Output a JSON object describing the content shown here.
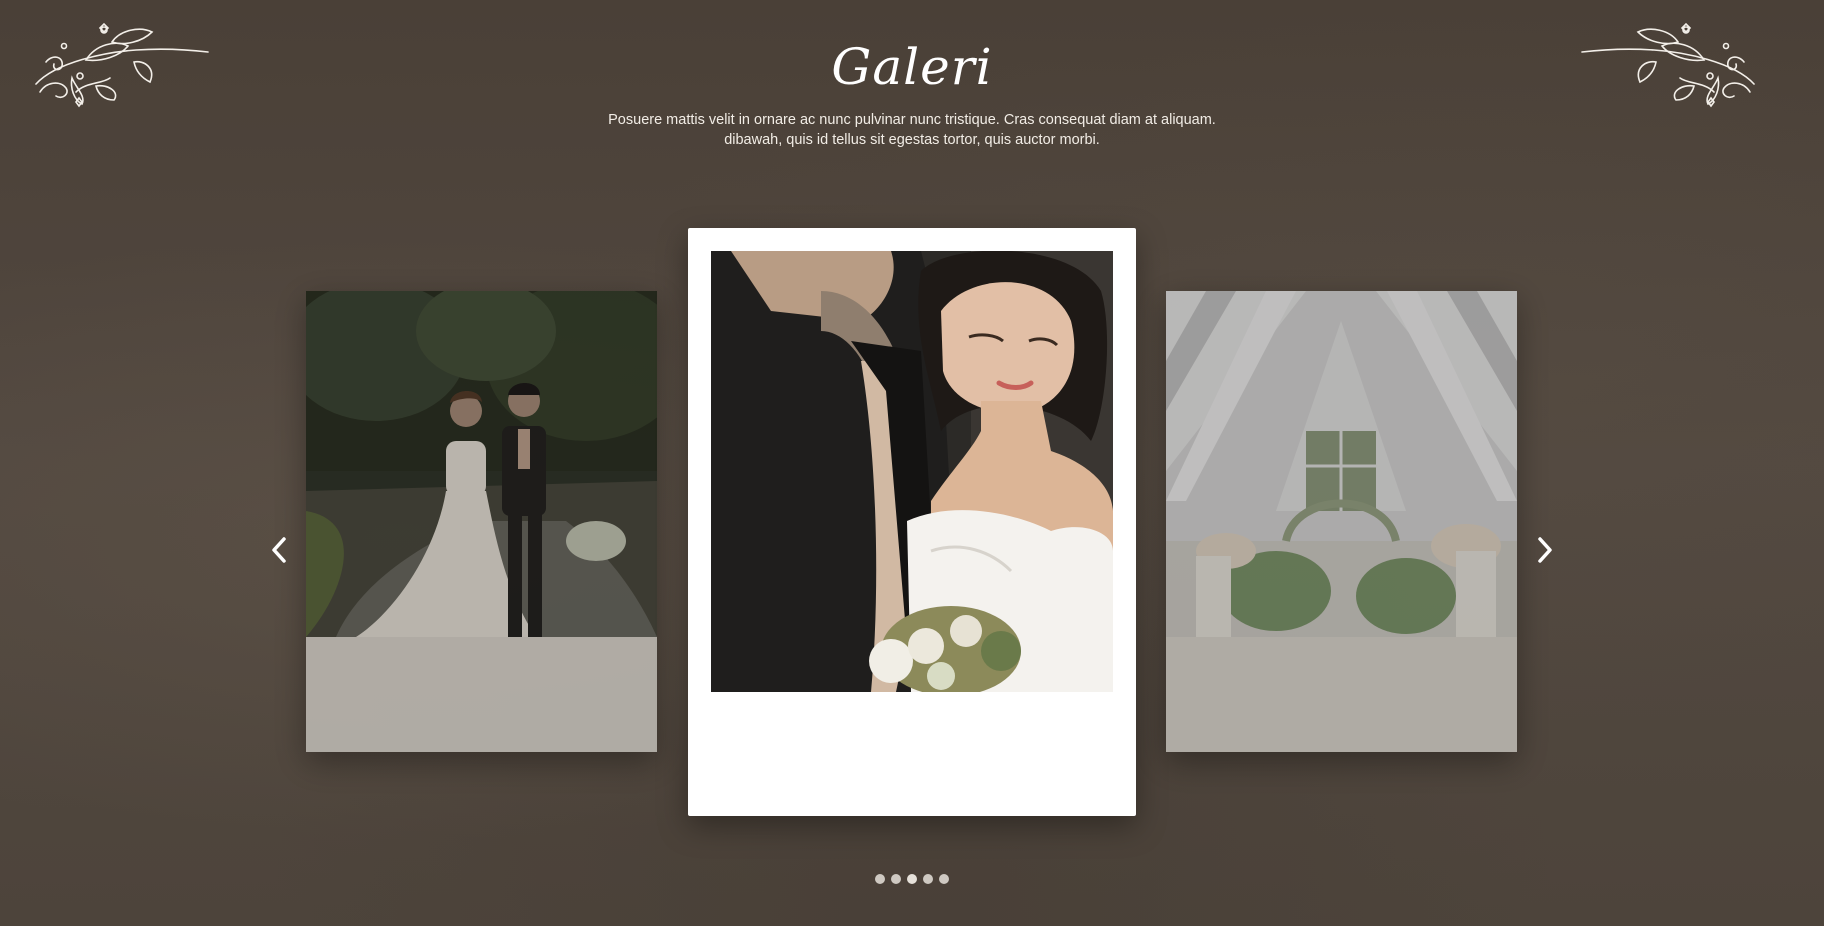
{
  "gallery": {
    "title": "Galeri",
    "description_line1": "Posuere mattis velit in ornare ac nunc pulvinar nunc tristique. Cras consequat diam at aliquam.",
    "description_line2": "dibawah, quis id tellus sit egestas tortor, quis auctor morbi."
  },
  "slides": [
    {
      "position": "previous",
      "photo": "bride-and-groom-walking-in-park"
    },
    {
      "position": "current",
      "photo": "bride-and-groom-close-embrace"
    },
    {
      "position": "next",
      "photo": "white-chapel-wedding-venue"
    }
  ],
  "navigation": {
    "prev_icon": "chevron-left-icon",
    "next_icon": "chevron-right-icon"
  },
  "pagination": {
    "total": 5
  },
  "colors": {
    "background": "#4f453c",
    "text": "#ffffff",
    "card": "#ffffff",
    "dot": "#cfc9c2"
  }
}
